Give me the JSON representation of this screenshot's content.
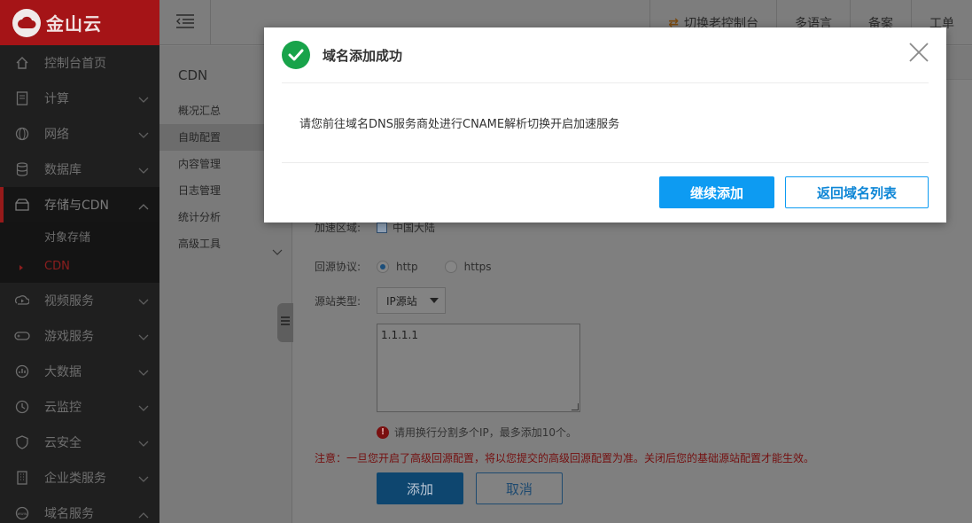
{
  "brand": {
    "name": "金山云"
  },
  "sidebar": {
    "items": [
      {
        "label": "控制台首页",
        "icon": "home-icon"
      },
      {
        "label": "计算",
        "icon": "server-icon"
      },
      {
        "label": "网络",
        "icon": "globe-icon"
      },
      {
        "label": "数据库",
        "icon": "database-icon"
      },
      {
        "label": "存储与CDN",
        "icon": "storage-icon",
        "active": true
      },
      {
        "label": "视频服务",
        "icon": "video-icon"
      },
      {
        "label": "游戏服务",
        "icon": "gamepad-icon"
      },
      {
        "label": "大数据",
        "icon": "bigdata-icon"
      },
      {
        "label": "云监控",
        "icon": "monitor-icon"
      },
      {
        "label": "云安全",
        "icon": "shield-icon"
      },
      {
        "label": "企业类服务",
        "icon": "building-icon"
      },
      {
        "label": "域名服务",
        "icon": "www-icon"
      }
    ],
    "subitems": [
      {
        "label": "对象存储"
      },
      {
        "label": "CDN",
        "current": true
      }
    ]
  },
  "topbar": {
    "switch_label": "切换老控制台",
    "language_label": "多语言",
    "record_label": "备案",
    "ticket_label": "工单"
  },
  "submenu": {
    "title": "CDN",
    "items": [
      "概况汇总",
      "自助配置",
      "内容管理",
      "日志管理",
      "统计分析",
      "高级工具"
    ]
  },
  "form": {
    "region_label": "加速区域:",
    "region_value": "中国大陆",
    "protocol_label": "回源协议:",
    "protocol_http": "http",
    "protocol_https": "https",
    "origin_type_label": "源站类型:",
    "origin_type_value": "IP源站",
    "origin_ips": "1.1.1.1",
    "hint": "请用换行分割多个IP，最多添加10个。",
    "warning": "注意：一旦您开启了高级回源配置，将以您提交的高级回源配置为准。关闭后您的基础源站配置才能生效。",
    "add_label": "添加",
    "cancel_label": "取消"
  },
  "modal": {
    "title": "域名添加成功",
    "message": "请您前往域名DNS服务商处进行CNAME解析切换开启加速服务",
    "continue_label": "继续添加",
    "back_label": "返回域名列表"
  },
  "colors": {
    "brand_red": "#e5262c",
    "success_green": "#18a34a",
    "primary_blue": "#0d9bf2"
  }
}
